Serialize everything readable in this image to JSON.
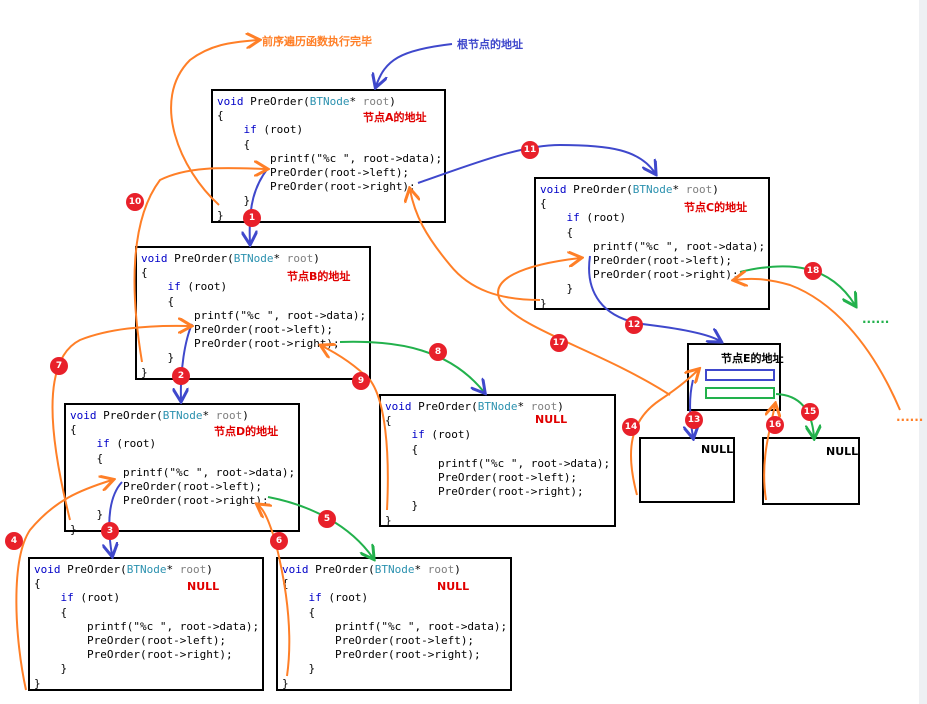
{
  "labels": {
    "done": "前序遍历函数执行完毕",
    "root_addr": "根节点的地址",
    "node_a": "节点A的地址",
    "node_b": "节点B的地址",
    "node_c": "节点C的地址",
    "node_d": "节点D的地址",
    "node_e": "节点E的地址",
    "null": "NULL",
    "ellipsis": "......"
  },
  "code": {
    "sig_void": "void",
    "sig_fn": " PreOrder(",
    "sig_type": "BTNode",
    "sig_star": "* ",
    "sig_param": "root",
    "sig_close": ")",
    "open_brace": "{",
    "if_kw": "if",
    "if_cond": " (root)",
    "printf": "printf(\"%c \", root->data);",
    "left": "PreOrder(root->left);",
    "right": "PreOrder(root->right);",
    "close_brace": "}"
  },
  "badges": [
    "1",
    "2",
    "3",
    "4",
    "5",
    "6",
    "7",
    "8",
    "9",
    "10",
    "11",
    "12",
    "13",
    "14",
    "15",
    "16",
    "17",
    "18"
  ],
  "colors": {
    "orange": "#ff7f27",
    "blue": "#3f48cc",
    "green": "#22b14c",
    "badge": "#e8202a",
    "null_label": "#e00000"
  }
}
